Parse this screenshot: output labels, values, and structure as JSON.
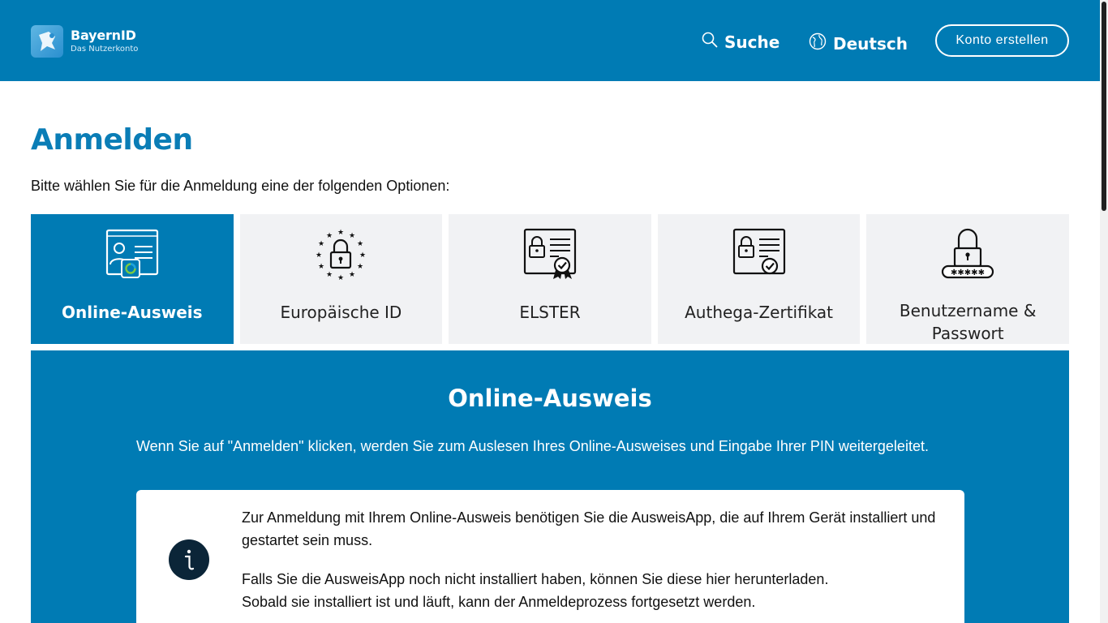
{
  "header": {
    "logo_name": "BayernID",
    "logo_sub": "Das Nutzerkonto",
    "search_label": "Suche",
    "language_label": "Deutsch",
    "create_account_label": "Konto erstellen"
  },
  "main": {
    "title": "Anmelden",
    "intro": "Bitte wählen Sie für die Anmeldung eine der folgenden Optionen:",
    "options": [
      {
        "label": "Online-Ausweis",
        "icon": "id-card-icon",
        "active": true
      },
      {
        "label": "Europäische ID",
        "icon": "eu-lock-icon",
        "active": false
      },
      {
        "label": "ELSTER",
        "icon": "certificate-lock-icon",
        "active": false
      },
      {
        "label": "Authega-Zertifikat",
        "icon": "certificate-lock-icon",
        "active": false
      },
      {
        "label": "Benutzername & Passwort",
        "icon": "password-lock-icon",
        "active": false
      }
    ]
  },
  "panel": {
    "title": "Online-Ausweis",
    "description": "Wenn Sie auf \"Anmelden\" klicken, werden Sie zum Auslesen Ihres Online-Ausweises und Eingabe Ihrer PIN weitergeleitet.",
    "info_p1": "Zur Anmeldung mit Ihrem Online-Ausweis benötigen Sie die AusweisApp, die auf Ihrem Gerät installiert und gestartet sein muss.",
    "info_p2_line1": "Falls Sie die AusweisApp noch nicht installiert haben, können Sie diese hier herunterladen.",
    "info_p2_line2": "Sobald sie installiert ist und läuft, kann der Anmeldeprozess fortgesetzt werden."
  },
  "colors": {
    "brand_blue": "#007bb4",
    "option_bg": "#f1f2f4",
    "info_icon_bg": "#0b2538"
  }
}
